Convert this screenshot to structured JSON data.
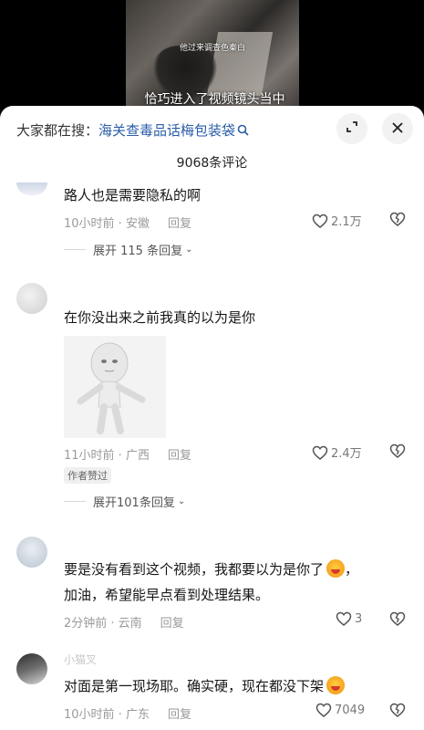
{
  "video": {
    "subtitle_small": "他过来调查色秦白",
    "subtitle_main": "恰巧进入了视频镜头当中"
  },
  "header": {
    "search_prefix": "大家都在搜：",
    "search_query": "海关查毒品话梅包装袋",
    "comment_count": "9068条评论"
  },
  "comments": [
    {
      "text": "路人也是需要隐私的啊",
      "time": "10小时前 · 安徽",
      "reply": "回复",
      "likes": "2.1万",
      "expand": "展开 115 条回复"
    },
    {
      "text": "在你没出来之前我真的以为是你",
      "time": "11小时前 · 广西",
      "reply": "回复",
      "likes": "2.4万",
      "badge": "作者赞过",
      "expand": "展开101条回复"
    },
    {
      "text_line1": "要是没有看到这个视频，我都要以为是你了",
      "text_line2": "，",
      "text_line3": "加油，希望能早点看到处理结果。",
      "time": "2分钟前 · 云南",
      "reply": "回复",
      "likes": "3"
    },
    {
      "username": "小猫叉",
      "text": "对面是第一现场耶。确实硬，现在都没下架",
      "time": "10小时前 · 广东",
      "reply": "回复",
      "likes": "7049"
    }
  ],
  "icons": {
    "search": "search-icon",
    "expand": "expand-arrows-icon",
    "close": "close-icon",
    "like": "heart-icon",
    "dislike": "broken-heart-icon",
    "emoji": "kiss-emoji-icon"
  },
  "colors": {
    "link": "#2a5da8",
    "text": "#161616",
    "meta": "#9a9a9a"
  }
}
